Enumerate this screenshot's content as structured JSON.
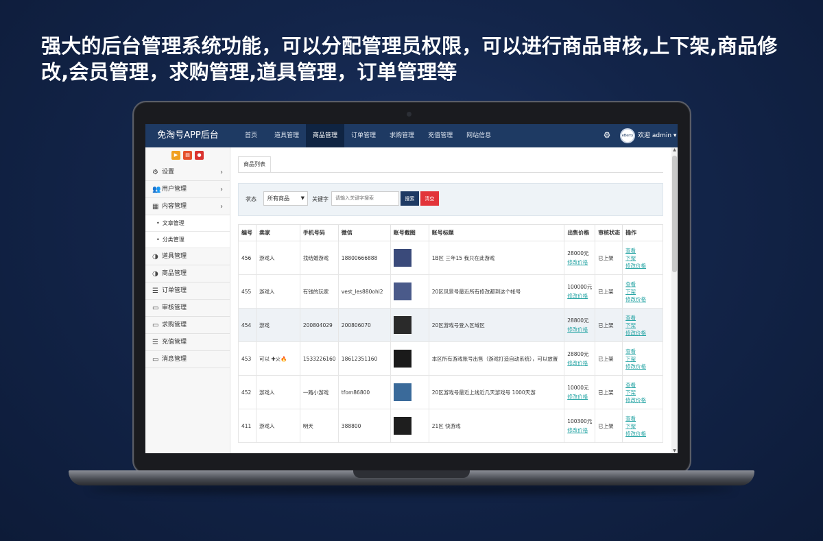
{
  "headline": "强大的后台管理系统功能，可以分配管理员权限，可以进行商品审核,上下架,商品修改,会员管理，求购管理,道具管理，订单管理等",
  "app": {
    "brand": "免淘号APP后台",
    "nav": [
      "首页",
      "道具管理",
      "商品管理",
      "订单管理",
      "求购管理",
      "充值管理",
      "网站信息"
    ],
    "avatar_text": "eBerry",
    "user_label": "欢迎 admin ▾",
    "settings_icon": "⚙"
  },
  "sidebar": {
    "shortcut_icons": [
      "▶",
      "▤",
      "●"
    ],
    "items": [
      {
        "icon": "⚙",
        "label": "设置",
        "arrow": "›"
      },
      {
        "icon": "👥",
        "label": "用户管理",
        "arrow": "›"
      },
      {
        "icon": "▦",
        "label": "内容管理",
        "arrow": "›"
      }
    ],
    "subitems": [
      "文章管理",
      "分类管理"
    ],
    "items2": [
      {
        "icon": "◑",
        "label": "道具管理"
      },
      {
        "icon": "◑",
        "label": "商品管理"
      },
      {
        "icon": "☰",
        "label": "订单管理"
      },
      {
        "icon": "▭",
        "label": "审核管理"
      },
      {
        "icon": "▭",
        "label": "求购管理"
      },
      {
        "icon": "☰",
        "label": "充值管理"
      },
      {
        "icon": "▭",
        "label": "消息管理"
      }
    ]
  },
  "main": {
    "tab": "商品列表",
    "filter": {
      "status_label": "状态",
      "status_value": "所有商品",
      "keyword_label": "关键字",
      "keyword_placeholder": "请输入关键字搜索",
      "search_btn": "搜索",
      "clear_btn": "清空"
    },
    "columns": [
      "编号",
      "卖家",
      "手机号码",
      "微信",
      "账号截图",
      "账号标题",
      "出售价格",
      "审核状态",
      "操作"
    ],
    "rows": [
      {
        "id": "456",
        "seller": "游戏人",
        "phone": "找结婚游戏",
        "wechat": "18800666888",
        "title": "1B区 三年15 我只在此游戏",
        "price": "28000元",
        "price_link": "修改价格",
        "status": "已上架",
        "actions": [
          "查看",
          "下架",
          "修改价格"
        ],
        "thumb": "#3a4a7a"
      },
      {
        "id": "455",
        "seller": "游戏人",
        "phone": "有钱的玩家",
        "wechat": "vest_les880ohl2",
        "title": "20区风景号最近所有修改都到这个帐号",
        "price": "100000元",
        "price_link": "修改价格",
        "status": "已上架",
        "actions": [
          "查看",
          "下架",
          "修改价格"
        ],
        "thumb": "#4a5a8a"
      },
      {
        "id": "454",
        "seller": "游戏",
        "phone": "200804029",
        "wechat": "200806070",
        "title": "20区游戏号登入区域区",
        "price": "28800元",
        "price_link": "修改价格",
        "status": "已上架",
        "actions": [
          "查看",
          "下架",
          "修改价格"
        ],
        "thumb": "#2a2a2a"
      },
      {
        "id": "453",
        "seller": "可以 ✚火🔥",
        "phone": "1533226160",
        "wechat": "18612351160",
        "title": "本区所有游戏账号出售（游戏打造自动系统），可以放置",
        "price": "28800元",
        "price_link": "修改价格",
        "status": "已上架",
        "actions": [
          "查看",
          "下架",
          "修改价格"
        ],
        "thumb": "#1a1a1a"
      },
      {
        "id": "452",
        "seller": "游戏人",
        "phone": "一路小游戏",
        "wechat": "tfom86800",
        "title": "20区游戏号最近上线近几天游戏号 1000天游",
        "price": "10000元",
        "price_link": "修改价格",
        "status": "已上架",
        "actions": [
          "查看",
          "下架",
          "修改价格"
        ],
        "thumb": "#3a6a9a"
      },
      {
        "id": "411",
        "seller": "游戏人",
        "phone": "明天",
        "wechat": "388800",
        "title": "21区 快游戏",
        "price": "100300元",
        "price_link": "修改价格",
        "status": "已上架",
        "actions": [
          "查看",
          "下架",
          "修改价格"
        ],
        "thumb": "#1e1e1e"
      }
    ]
  },
  "colors": {
    "topbar": "#1e3a63",
    "link": "#2aa6a6",
    "danger": "#e2343a"
  }
}
